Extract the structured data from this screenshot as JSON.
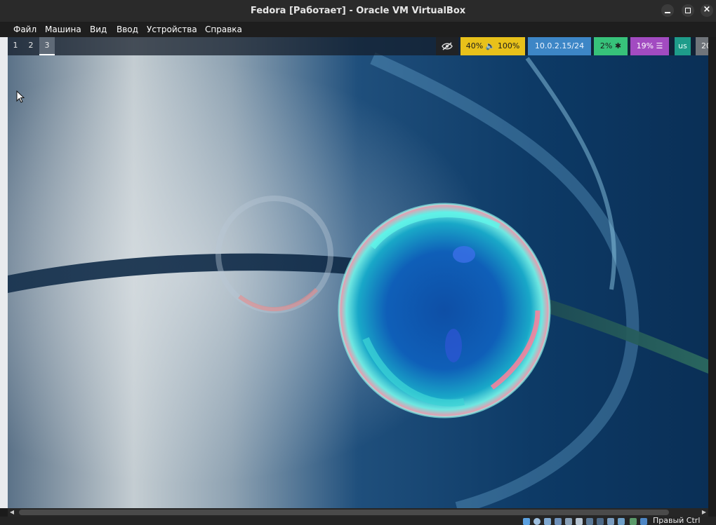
{
  "window": {
    "title": "Fedora [Работает] - Oracle VM VirtualBox"
  },
  "menu": {
    "items": [
      "Файл",
      "Машина",
      "Вид",
      "Ввод",
      "Устройства",
      "Справка"
    ]
  },
  "guest": {
    "workspaces": [
      "1",
      "2",
      "3"
    ],
    "active_workspace": "3",
    "status_blocks": {
      "audio": "40% 🔈 100%",
      "network": "10.0.2.15/24",
      "cpu": "2% ✱",
      "memory": "19% ☰",
      "keyboard_layout": "us",
      "clock": "20"
    },
    "icons": {
      "visibility": "eye-slash-icon",
      "cursor": "mouse-pointer-icon"
    },
    "colors": {
      "audio": "#e8c11a",
      "network": "#3d86c6",
      "cpu": "#37c27a",
      "memory": "#a24bc1",
      "keyboard": "#1e9c8a",
      "clock": "#6f747a"
    }
  },
  "statusbar": {
    "host_key_label": "Правый Ctrl"
  }
}
